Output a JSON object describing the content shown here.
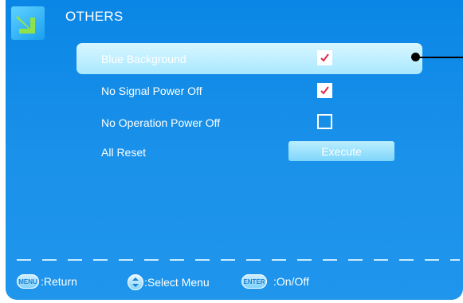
{
  "menu": {
    "title": "OTHERS",
    "icon": "menu-arrow-icon"
  },
  "items": [
    {
      "label": "Blue Background",
      "control": "checkbox",
      "checked": true,
      "selected": true
    },
    {
      "label": "No Signal Power Off",
      "control": "checkbox",
      "checked": true,
      "selected": false
    },
    {
      "label": "No Operation Power Off",
      "control": "checkbox",
      "checked": false,
      "selected": false
    },
    {
      "label": "All Reset",
      "control": "button",
      "button_label": "Execute",
      "selected": false
    }
  ],
  "footer": {
    "menu_key": "MENU",
    "return_label": ":Return",
    "select_label": ":Select Menu",
    "enter_key": "ENTER",
    "onoff_label": ":On/Off"
  },
  "colors": {
    "background": "#0a86e6",
    "highlight": "#bff0ff",
    "check": "#e0284a"
  }
}
